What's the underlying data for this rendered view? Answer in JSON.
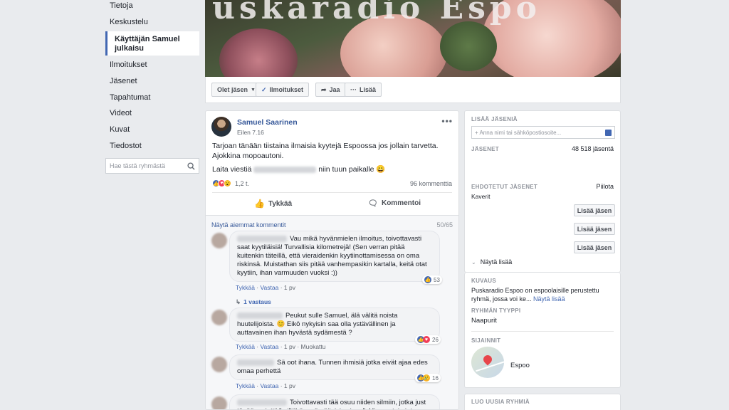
{
  "sidebar": {
    "items": [
      {
        "label": "Tietoja"
      },
      {
        "label": "Keskustelu"
      },
      {
        "label": "Käyttäjän Samuel julkaisu"
      },
      {
        "label": "Ilmoitukset"
      },
      {
        "label": "Jäsenet"
      },
      {
        "label": "Tapahtumat"
      },
      {
        "label": "Videot"
      },
      {
        "label": "Kuvat"
      },
      {
        "label": "Tiedostot"
      }
    ],
    "search_placeholder": "Hae tästä ryhmästä"
  },
  "cover": {
    "title": "uskaradio Espo"
  },
  "group_actions": {
    "member_label": "Olet jäsen",
    "notifications_label": "Ilmoitukset",
    "share_label": "Jaa",
    "more_label": "Lisää"
  },
  "post": {
    "author": "Samuel Saarinen",
    "time": "Eilen 7.16",
    "line1": "Tarjoan tänään tiistaina ilmaisia kyytejä Espoossa jos jollain tarvetta.",
    "line2": "Ajokkina mopoautoni.",
    "line3_start": "Laita viestiä",
    "line3_end": "niin tuun paikalle 😀",
    "reaction_count": "1,2 t.",
    "comment_count": "96 kommenttia",
    "like_label": "Tykkää",
    "comment_label": "Kommentoi"
  },
  "comments_section": {
    "show_more": "Näytä aiemmat kommentit",
    "page": "50/65",
    "like_label": "Tykkää",
    "reply_label": "Vastaa",
    "comments": [
      {
        "text": "Vau mikä hyvänmielen ilmoitus, toivottavasti saat kyytiläisiä! Turvallisia kilometrejä! (Sen verran pitää kuitenkin täteillä, että vieraidenkin kyytiinottamisessa on oma riskinsä. Muistathan siis pitää vanhempasikin kartalla, keitä otat kyytiin, ihan varmuuden vuoksi :))",
        "time": "1 pv",
        "reactions": "53"
      },
      {
        "text": "Peukut sulle Samuel, älä välitä noista huutelijoista. 😊 Eikö nykyisin saa olla ystävällinen ja auttavainen ihan hyvästä sydämestä ?",
        "time": "1 pv",
        "edited": "Muokattu",
        "reactions": "26"
      },
      {
        "text": "Sä oot ihana. Tunnen ihmisiä jotka eivät ajaa edes omaa perhettä",
        "time": "1 pv",
        "reactions": "16"
      },
      {
        "text": "Toivottavasti tää osuu niiden silmiin, jotka just tänään miettii \"millähän mä pääsisin sinne\". Hienoa toimintaa auttaa"
      }
    ],
    "replies": "1 vastaus"
  },
  "right": {
    "add_members": {
      "title": "LISÄÄ JÄSENIÄ",
      "placeholder": "+ Anna nimi tai sähköpostiosoite..."
    },
    "members": {
      "title": "JÄSENET",
      "count": "48 518 jäsentä"
    },
    "suggested": {
      "title": "EHDOTETUT JÄSENET",
      "hide": "Piilota",
      "friends": "Kaverit",
      "add_label": "Lisää jäsen",
      "show_more": "Näytä lisää"
    },
    "description": {
      "title": "KUVAUS",
      "text": "Puskaradio Espoo on espoolaisille perustettu ryhmä, jossa voi ke...",
      "more": "Näytä lisää"
    },
    "group_type": {
      "title": "RYHMÄN TYYPPI",
      "value": "Naapurit"
    },
    "location": {
      "title": "SIJAINNIT",
      "value": "Espoo"
    },
    "create": {
      "title": "LUO UUSIA RYHMIÄ"
    }
  },
  "colors": {
    "accent": "#4267b2",
    "link": "#365899",
    "background": "#e9ebee"
  }
}
